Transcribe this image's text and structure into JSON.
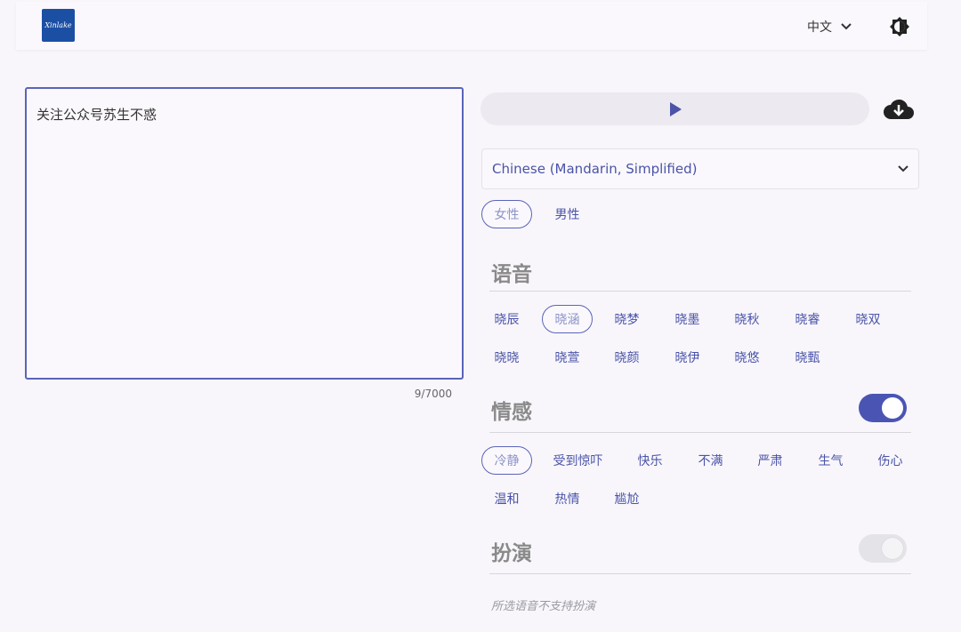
{
  "header": {
    "logo_text": "Xinlake",
    "language": "中文"
  },
  "editor": {
    "text": "关注公众号苏生不惑",
    "counter": "9/7000"
  },
  "voice_language": "Chinese (Mandarin, Simplified)",
  "gender": {
    "options": [
      "女性",
      "男性"
    ],
    "selected": "女性"
  },
  "voice_section": {
    "title": "语音",
    "voices": [
      "晓辰",
      "晓涵",
      "晓梦",
      "晓墨",
      "晓秋",
      "晓睿",
      "晓双",
      "晓晓",
      "晓萱",
      "晓颜",
      "晓伊",
      "晓悠",
      "晓甄"
    ],
    "selected": "晓涵"
  },
  "emotion_section": {
    "title": "情感",
    "enabled": true,
    "emotions": [
      "冷静",
      "受到惊吓",
      "快乐",
      "不满",
      "严肃",
      "生气",
      "伤心",
      "温和",
      "热情",
      "尴尬"
    ],
    "selected": "冷静"
  },
  "roleplay_section": {
    "title": "扮演",
    "enabled": false,
    "note": "所选语音不支持扮演"
  },
  "colors": {
    "accent": "#4a53a8",
    "toggle_on": "#4a55b3",
    "logo_bg": "#1b4fa3"
  },
  "icons": [
    "theme-toggle-icon",
    "chevron-down-icon",
    "play-icon",
    "cloud-download-icon"
  ]
}
